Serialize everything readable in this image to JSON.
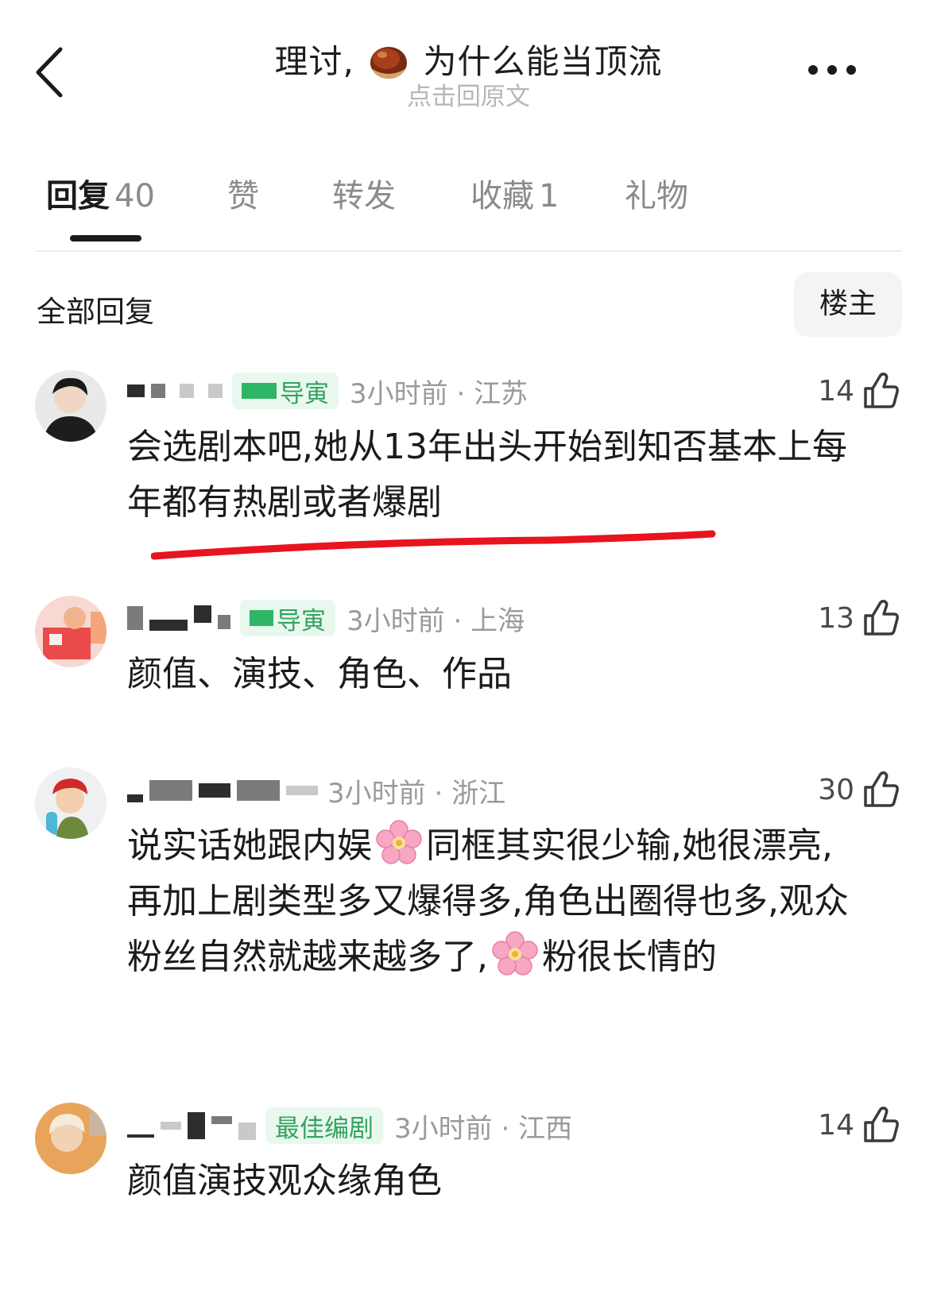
{
  "header": {
    "title_prefix": "理讨,",
    "title_suffix": "为什么能当顶流",
    "subtitle": "点击回原文",
    "emoji_icon": "chestnut-icon"
  },
  "tabs": [
    {
      "label": "回复",
      "count": "40",
      "active": true
    },
    {
      "label": "赞",
      "count": ""
    },
    {
      "label": "转发",
      "count": ""
    },
    {
      "label": "收藏",
      "count": "1"
    },
    {
      "label": "礼物",
      "count": ""
    }
  ],
  "filter": {
    "label": "全部回复",
    "op_button": "楼主"
  },
  "comments": [
    {
      "badge": "导寅",
      "time": "3小时前",
      "location": "江苏",
      "likes": "14",
      "text": "会选剧本吧,她从13年出头开始到知否基本上每年都有热剧或者爆剧"
    },
    {
      "badge": "导寅",
      "time": "3小时前",
      "location": "上海",
      "likes": "13",
      "text": "颜值、演技、角色、作品"
    },
    {
      "badge": "",
      "time": "3小时前",
      "location": "浙江",
      "likes": "30",
      "text_parts": [
        "说实话她跟内娱",
        "同框其实很少输,她很漂亮,再加上剧类型多又爆得多,角色出圈得也多,观众粉丝自然就越来越多了,",
        "粉很长情的"
      ]
    },
    {
      "badge": "最佳编剧",
      "time": "3小时前",
      "location": "江西",
      "likes": "14",
      "text": "颜值演技观众缘角色"
    }
  ],
  "colors": {
    "badge_bg": "#e9f8ef",
    "badge_text": "#34a35f",
    "annotation_red": "#e8141e",
    "muted": "#9a9a9a"
  }
}
